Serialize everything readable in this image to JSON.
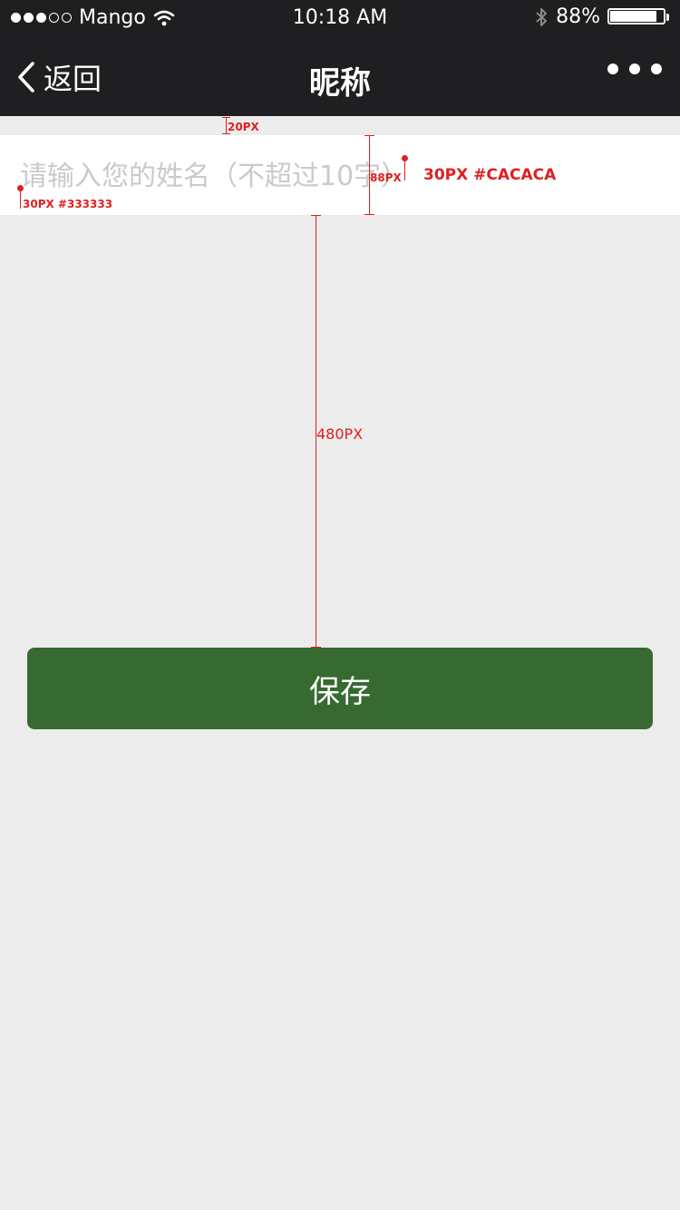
{
  "status_bar": {
    "carrier": "Mango",
    "time": "10:18 AM",
    "battery": "88%",
    "battery_level": 0.88,
    "signal_strength": 3,
    "signal_total": 5,
    "icons": [
      "signal-dots-icon",
      "wifi-icon",
      "bluetooth-icon",
      "battery-icon"
    ]
  },
  "nav": {
    "back_label": "返回",
    "title": "昵称",
    "more_icon": "more-dots-icon",
    "background": "#1f1f21"
  },
  "form": {
    "name_placeholder": "请输入您的姓名（不超过10字）",
    "name_value": "",
    "save_label": "保存",
    "button_color": "#366a31",
    "page_background": "#ececec"
  },
  "annotations": {
    "gap_top": "20PX",
    "row_height": "88PX",
    "placeholder_spec": "30PX #CACACA",
    "text_spec": "30PX #333333",
    "gap_to_button": "480PX",
    "color": "#e02020"
  }
}
